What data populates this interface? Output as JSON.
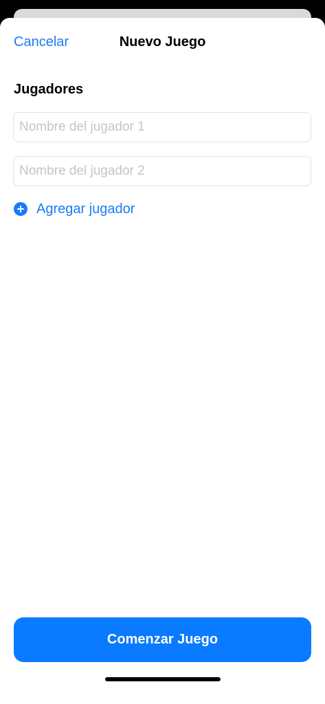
{
  "nav": {
    "cancel_label": "Cancelar",
    "title": "Nuevo Juego"
  },
  "players_section": {
    "header": "Jugadores",
    "inputs": [
      {
        "value": "",
        "placeholder": "Nombre del jugador 1"
      },
      {
        "value": "",
        "placeholder": "Nombre del jugador 2"
      }
    ],
    "add_player_icon": "plus-circle-icon",
    "add_player_label": "Agregar jugador"
  },
  "start_button_label": "Comenzar Juego",
  "colors": {
    "accent": "#0a7aff",
    "link": "#1a7cf5",
    "placeholder": "#c4c4c8",
    "field_border": "#e2e2e6"
  }
}
